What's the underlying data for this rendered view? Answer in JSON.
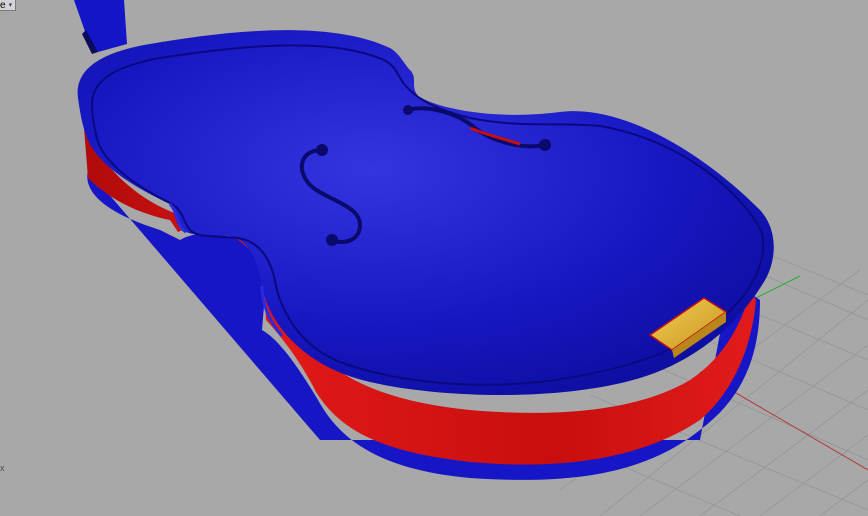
{
  "viewport": {
    "title_fragment": "e",
    "menu_glyph": "▾",
    "axes_glyph": "x",
    "colors": {
      "background": "#a8a8a8",
      "grid": "#8f8f8f",
      "x_axis": "#b23a3a",
      "y_axis": "#2fae3a",
      "top_plate": "#1a1ad0",
      "ribs": "#d61212",
      "end_block": "#e6b830"
    },
    "icons": {
      "menu": "chevron-down-icon"
    }
  }
}
